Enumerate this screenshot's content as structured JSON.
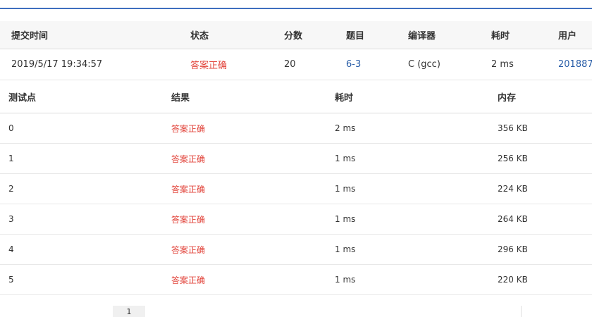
{
  "submission": {
    "headers": [
      "提交时间",
      "状态",
      "分数",
      "题目",
      "编译器",
      "耗时",
      "用户"
    ],
    "row": {
      "time": "2019/5/17 19:34:57",
      "status": "答案正确",
      "score": "20",
      "problem": "6-3",
      "compiler": "C (gcc)",
      "duration": "2 ms",
      "user": "201887"
    }
  },
  "cases": {
    "headers": [
      "测试点",
      "结果",
      "耗时",
      "内存"
    ],
    "rows": [
      {
        "id": "0",
        "result": "答案正确",
        "time": "2 ms",
        "memory": "356 KB"
      },
      {
        "id": "1",
        "result": "答案正确",
        "time": "1 ms",
        "memory": "256 KB"
      },
      {
        "id": "2",
        "result": "答案正确",
        "time": "1 ms",
        "memory": "224 KB"
      },
      {
        "id": "3",
        "result": "答案正确",
        "time": "1 ms",
        "memory": "264 KB"
      },
      {
        "id": "4",
        "result": "答案正确",
        "time": "1 ms",
        "memory": "296 KB"
      },
      {
        "id": "5",
        "result": "答案正确",
        "time": "1 ms",
        "memory": "220 KB"
      }
    ]
  },
  "pagination": {
    "current_page": "1"
  },
  "colors": {
    "accent_rule": "#3f6fbf",
    "status_ok": "#e2453c",
    "link": "#2a5ea8"
  }
}
